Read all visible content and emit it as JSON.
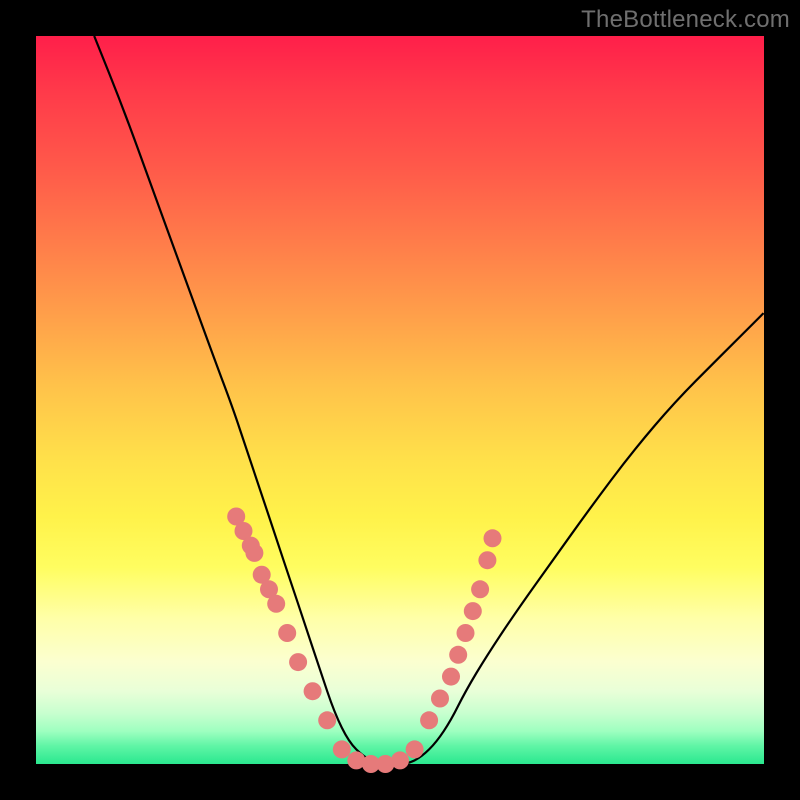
{
  "watermark": "TheBottleneck.com",
  "colors": {
    "background": "#000000",
    "curve": "#000000",
    "dots": "#e67a7a"
  },
  "chart_data": {
    "type": "line",
    "title": "",
    "xlabel": "",
    "ylabel": "",
    "xlim": [
      0,
      100
    ],
    "ylim": [
      0,
      100
    ],
    "grid": false,
    "legend": false,
    "annotations": [
      "TheBottleneck.com"
    ],
    "series": [
      {
        "name": "bottleneck-curve",
        "comment": "V-shaped curve; y≈100 at x≈8, drops to y≈0 around x≈42–52, rises to y≈62 at x=100. Values estimated from pixel positions on a 0–100 normalized axis.",
        "x": [
          8,
          12,
          16,
          20,
          24,
          27,
          29,
          31,
          33,
          35,
          37,
          39,
          41,
          43,
          45,
          47,
          49,
          51,
          53,
          55,
          57,
          59,
          62,
          66,
          71,
          76,
          82,
          88,
          94,
          100
        ],
        "y": [
          100,
          90,
          79,
          68,
          57,
          49,
          43,
          37,
          31,
          25,
          19,
          13,
          7,
          3,
          1,
          0,
          0,
          0,
          1,
          3,
          6,
          10,
          15,
          21,
          28,
          35,
          43,
          50,
          56,
          62
        ]
      },
      {
        "name": "left-arm-dots",
        "type": "scatter",
        "comment": "Cluster of salmon dots along lower-left arm of the V.",
        "x": [
          27.5,
          28.5,
          29.5,
          30,
          31,
          32,
          33,
          34.5,
          36,
          38,
          40
        ],
        "y": [
          34,
          32,
          30,
          29,
          26,
          24,
          22,
          18,
          14,
          10,
          6
        ]
      },
      {
        "name": "floor-dots",
        "type": "scatter",
        "comment": "Dots along the flat bottom of the V.",
        "x": [
          42,
          44,
          46,
          48,
          50,
          52
        ],
        "y": [
          2,
          0.5,
          0,
          0,
          0.5,
          2
        ]
      },
      {
        "name": "right-arm-dots",
        "type": "scatter",
        "comment": "Cluster of salmon dots along lower-right arm of the V.",
        "x": [
          54,
          55.5,
          57,
          58,
          59,
          60,
          61,
          62,
          62.7
        ],
        "y": [
          6,
          9,
          12,
          15,
          18,
          21,
          24,
          28,
          31
        ]
      }
    ]
  }
}
